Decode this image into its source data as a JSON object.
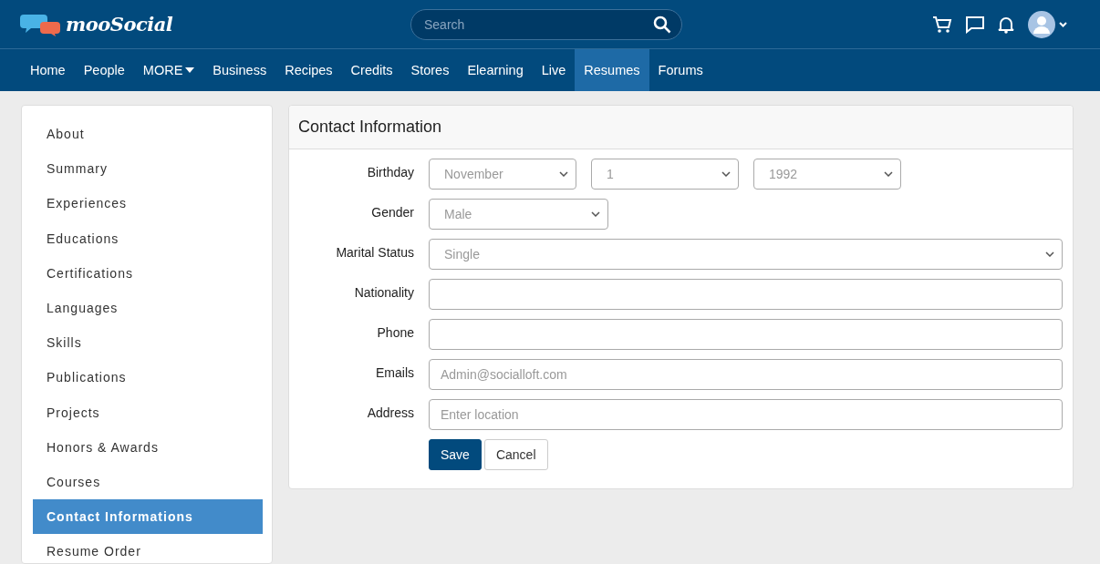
{
  "brand": "mooSocial",
  "search": {
    "placeholder": "Search"
  },
  "nav": [
    {
      "label": "Home",
      "selected": false,
      "dropdown": false
    },
    {
      "label": "People",
      "selected": false,
      "dropdown": false
    },
    {
      "label": "MORE",
      "selected": false,
      "dropdown": true
    },
    {
      "label": "Business",
      "selected": false,
      "dropdown": false
    },
    {
      "label": "Recipes",
      "selected": false,
      "dropdown": false
    },
    {
      "label": "Credits",
      "selected": false,
      "dropdown": false
    },
    {
      "label": "Stores",
      "selected": false,
      "dropdown": false
    },
    {
      "label": "Elearning",
      "selected": false,
      "dropdown": false
    },
    {
      "label": "Live",
      "selected": false,
      "dropdown": false
    },
    {
      "label": "Resumes",
      "selected": true,
      "dropdown": false
    },
    {
      "label": "Forums",
      "selected": false,
      "dropdown": false
    }
  ],
  "sidebar": {
    "items": [
      {
        "label": "About",
        "selected": false
      },
      {
        "label": "Summary",
        "selected": false
      },
      {
        "label": "Experiences",
        "selected": false
      },
      {
        "label": "Educations",
        "selected": false
      },
      {
        "label": "Certifications",
        "selected": false
      },
      {
        "label": "Languages",
        "selected": false
      },
      {
        "label": "Skills",
        "selected": false
      },
      {
        "label": "Publications",
        "selected": false
      },
      {
        "label": "Projects",
        "selected": false
      },
      {
        "label": "Honors & Awards",
        "selected": false
      },
      {
        "label": "Courses",
        "selected": false
      },
      {
        "label": "Contact Informations",
        "selected": true
      },
      {
        "label": "Resume Order",
        "selected": false
      }
    ]
  },
  "form": {
    "title": "Contact Information",
    "fields": [
      {
        "label": "Birthday",
        "kind": "selects",
        "values": [
          "November",
          "1",
          "1992"
        ]
      },
      {
        "label": "Gender",
        "kind": "select",
        "value": "Male"
      },
      {
        "label": "Marital Status",
        "kind": "select-wide",
        "value": "Single"
      },
      {
        "label": "Nationality",
        "kind": "text"
      },
      {
        "label": "Phone",
        "kind": "text"
      },
      {
        "label": "Emails",
        "kind": "text",
        "placeholder": "Admin@socialloft.com"
      },
      {
        "label": "Address",
        "kind": "text",
        "placeholder": "Enter location"
      }
    ],
    "buttons": [
      {
        "label": "Save",
        "kind": "primary"
      },
      {
        "label": "Cancel",
        "kind": "secondary"
      }
    ]
  }
}
